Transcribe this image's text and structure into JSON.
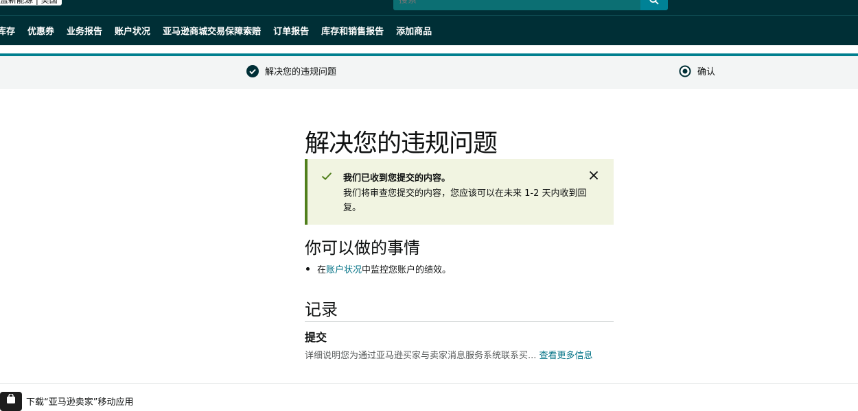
{
  "header": {
    "store_label": "盖新能源 | 美国",
    "search_placeholder": "搜索"
  },
  "nav": {
    "items": [
      "库存",
      "优惠券",
      "业务报告",
      "账户状况",
      "亚马逊商城交易保障索赔",
      "订单报告",
      "库存和销售报告",
      "添加商品"
    ]
  },
  "steps": {
    "step1": "解决您的违规问题",
    "step2": "确认"
  },
  "main": {
    "title": "解决您的违规问题",
    "alert": {
      "title": "我们已收到您提交的内容。",
      "body": "我们将审查您提交的内容，您应该可以在未来 1-2 天内收到回复。"
    },
    "actions": {
      "heading": "你可以做的事情",
      "prefix": "在",
      "link": "账户状况",
      "suffix": "中监控您账户的绩效。"
    },
    "records": {
      "heading": "记录",
      "sub": "提交",
      "detail": "详细说明您为通过亚马逊买家与卖家消息服务系统联系买...",
      "more_link": "查看更多信息"
    }
  },
  "footer": {
    "app_text": "下载“亚马逊卖家”移动应用"
  },
  "colors": {
    "header_bg": "#002f36",
    "accent": "#007f8f",
    "success": "#507f1c"
  }
}
